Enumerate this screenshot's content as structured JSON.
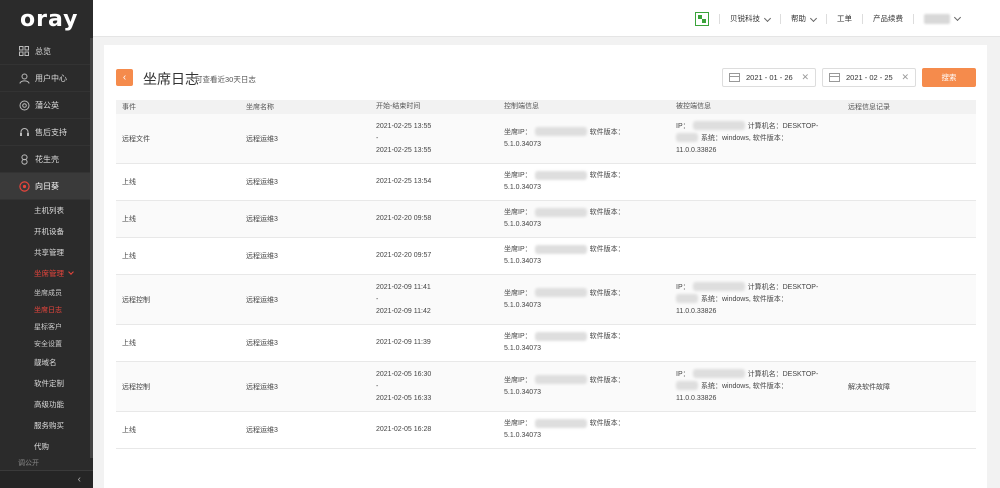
{
  "brand": "oray",
  "sidebar": {
    "items": [
      {
        "label": "总览",
        "icon": "grid-icon"
      },
      {
        "label": "用户中心",
        "icon": "user-icon"
      },
      {
        "label": "蒲公英",
        "icon": "dandelion-icon"
      },
      {
        "label": "售后支持",
        "icon": "support-icon"
      },
      {
        "label": "花生壳",
        "icon": "peanut-icon"
      },
      {
        "label": "向日葵",
        "icon": "sunflower-icon"
      }
    ],
    "sub_items": [
      "主机列表",
      "开机设备",
      "共享管理"
    ],
    "group_open": "坐席管理",
    "group_items": [
      "坐席成员",
      "坐席日志",
      "星标客户"
    ],
    "sub_items2": [
      "安全设置",
      "靓域名",
      "软件定制",
      "高级功能",
      "服务购买",
      "代购"
    ],
    "peek": "调公开",
    "collapse_glyph": "‹"
  },
  "topbar": {
    "company": "贝锐科技",
    "help": "帮助",
    "ticket": "工单",
    "products": "产品续费"
  },
  "page": {
    "back_glyph": "‹",
    "title": "坐席日志",
    "subtitle": "可查看近30天日志",
    "date_start": "2021 - 01 - 26",
    "date_end": "2021 - 02 - 25",
    "clear_glyph": "✕",
    "search_label": "搜索"
  },
  "table": {
    "headers": [
      "事件",
      "坐席名称",
      "开始-结束时间",
      "控制端信息",
      "被控端信息",
      "远程信息记录"
    ],
    "labels": {
      "seat_ip": "坐席IP：",
      "sw_version": "软件版本：",
      "ip": "IP：",
      "computer_name": "计算机名：DESKTOP-",
      "system": "系统：windows, 软件版本：",
      "dash": "-"
    },
    "rows": [
      {
        "event": "远程文件",
        "seat": "远程运维3",
        "start": "2021-02-25 13:55",
        "end": "2021-02-25 13:55",
        "ctrl_ver": "5.1.0.34073",
        "target_ver": "11.0.0.33826",
        "record": "",
        "has_target": true
      },
      {
        "event": "上线",
        "seat": "远程运维3",
        "start": "2021-02-25 13:54",
        "end": "",
        "ctrl_ver": "5.1.0.34073",
        "target_ver": "",
        "record": "",
        "has_target": false
      },
      {
        "event": "上线",
        "seat": "远程运维3",
        "start": "2021-02-20 09:58",
        "end": "",
        "ctrl_ver": "5.1.0.34073",
        "target_ver": "",
        "record": "",
        "has_target": false
      },
      {
        "event": "上线",
        "seat": "远程运维3",
        "start": "2021-02-20 09:57",
        "end": "",
        "ctrl_ver": "5.1.0.34073",
        "target_ver": "",
        "record": "",
        "has_target": false
      },
      {
        "event": "远程控制",
        "seat": "远程运维3",
        "start": "2021-02-09 11:41",
        "end": "2021-02-09 11:42",
        "ctrl_ver": "5.1.0.34073",
        "target_ver": "11.0.0.33826",
        "record": "",
        "has_target": true
      },
      {
        "event": "上线",
        "seat": "远程运维3",
        "start": "2021-02-09 11:39",
        "end": "",
        "ctrl_ver": "5.1.0.34073",
        "target_ver": "",
        "record": "",
        "has_target": false
      },
      {
        "event": "远程控制",
        "seat": "远程运维3",
        "start": "2021-02-05 16:30",
        "end": "2021-02-05 16:33",
        "ctrl_ver": "5.1.0.34073",
        "target_ver": "11.0.0.33826",
        "record": "解决软件故障",
        "has_target": true
      },
      {
        "event": "上线",
        "seat": "远程运维3",
        "start": "2021-02-05 16:28",
        "end": "",
        "ctrl_ver": "5.1.0.34073",
        "target_ver": "",
        "record": "",
        "has_target": false
      }
    ]
  }
}
